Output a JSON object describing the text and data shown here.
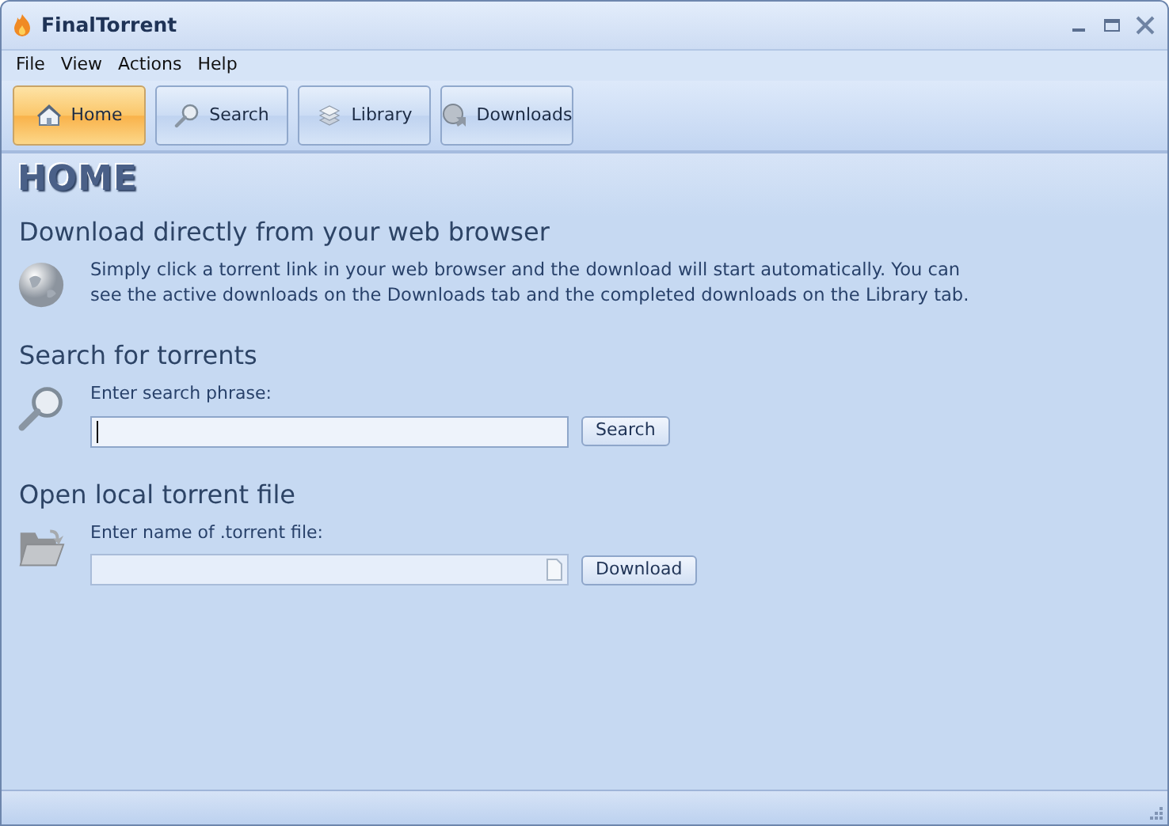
{
  "window": {
    "title": "FinalTorrent"
  },
  "menu": [
    "File",
    "View",
    "Actions",
    "Help"
  ],
  "toolbar": [
    {
      "label": "Home",
      "selected": true
    },
    {
      "label": "Search",
      "selected": false
    },
    {
      "label": "Library",
      "selected": false
    },
    {
      "label": "Downloads",
      "selected": false
    }
  ],
  "page": {
    "heading": "HOME",
    "sections": [
      {
        "kind": "info",
        "title": "Download directly from your web browser",
        "text": "Simply click a torrent link in your web browser and the download will start automatically. You can see the active downloads on the Downloads tab and the completed downloads on the Library tab."
      },
      {
        "kind": "search",
        "title": "Search for torrents",
        "label": "Enter search phrase:",
        "button": "Search",
        "focused": true
      },
      {
        "kind": "file",
        "title": "Open local torrent file",
        "label": "Enter name of .torrent file:",
        "button": "Download",
        "focused": false
      }
    ]
  }
}
